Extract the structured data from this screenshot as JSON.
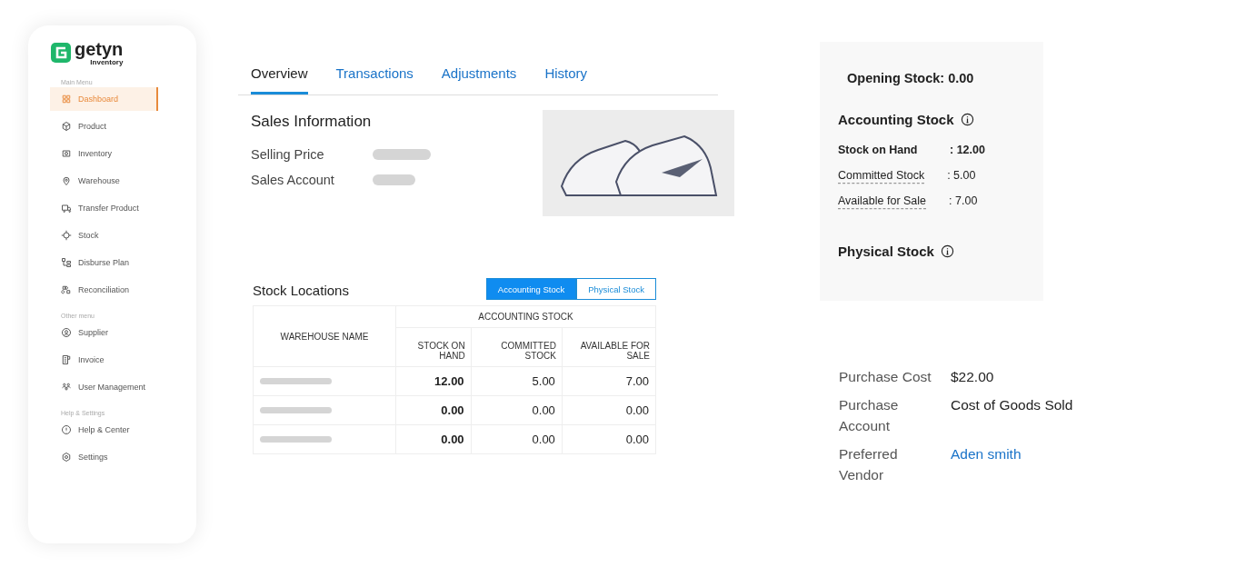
{
  "sidebar": {
    "logo": {
      "name": "getyn",
      "subtitle": "Inventory"
    },
    "sections": [
      {
        "title": "Main Menu",
        "items": [
          {
            "label": "Dashboard",
            "selected": true
          },
          {
            "label": "Product",
            "selected": false
          },
          {
            "label": "Inventory",
            "selected": false
          },
          {
            "label": "Warehouse",
            "selected": false
          },
          {
            "label": "Transfer Product",
            "selected": false
          },
          {
            "label": "Stock",
            "selected": false
          },
          {
            "label": "Disburse Plan",
            "selected": false
          },
          {
            "label": "Reconciliation",
            "selected": false
          }
        ]
      },
      {
        "title": "Other menu",
        "items": [
          {
            "label": "Supplier",
            "selected": false
          },
          {
            "label": "Invoice",
            "selected": false
          },
          {
            "label": "User Management",
            "selected": false
          }
        ]
      },
      {
        "title": "Help & Settings",
        "items": [
          {
            "label": "Help & Center",
            "selected": false
          },
          {
            "label": "Settings",
            "selected": false
          }
        ]
      }
    ]
  },
  "tabs": [
    {
      "label": "Overview",
      "selected": true
    },
    {
      "label": "Transactions",
      "selected": false
    },
    {
      "label": "Adjustments",
      "selected": false
    },
    {
      "label": "History",
      "selected": false
    }
  ],
  "sales_information": {
    "title": "Sales Information",
    "fields": [
      {
        "label": "Selling Price"
      },
      {
        "label": "Sales Account"
      }
    ]
  },
  "stock_locations": {
    "title": "Stock Locations",
    "toggle": [
      {
        "label": "Accounting Stock",
        "selected": true
      },
      {
        "label": "Physical Stock",
        "selected": false
      }
    ],
    "group_header": "ACCOUNTING STOCK",
    "columns": [
      "WAREHOUSE NAME",
      "STOCK ON HAND",
      "COMMITTED STOCK",
      "AVAILABLE FOR SALE"
    ],
    "rows": [
      {
        "stock_on_hand": "12.00",
        "committed_stock": "5.00",
        "available_for_sale": "7.00"
      },
      {
        "stock_on_hand": "0.00",
        "committed_stock": "0.00",
        "available_for_sale": "0.00"
      },
      {
        "stock_on_hand": "0.00",
        "committed_stock": "0.00",
        "available_for_sale": "0.00"
      }
    ]
  },
  "stock_panel": {
    "opening_stock": "Opening Stock: 0.00",
    "accounting_title": "Accounting Stock",
    "rows": [
      {
        "kind": "total",
        "label": "Stock on Hand",
        "value": ": 12.00"
      },
      {
        "kind": "detail",
        "label": "Committed Stock",
        "value": ": 5.00"
      },
      {
        "kind": "detail",
        "label": "Available for Sale",
        "value": ": 7.00"
      }
    ],
    "physical_title": "Physical Stock"
  },
  "purchase": [
    {
      "kind": "text",
      "label": "Purchase Cost",
      "value": "$22.00"
    },
    {
      "kind": "text",
      "label": "Purchase Account",
      "value": "Cost of Goods Sold"
    },
    {
      "kind": "link",
      "label": "Preferred Vendor",
      "value": "Aden smith"
    }
  ]
}
